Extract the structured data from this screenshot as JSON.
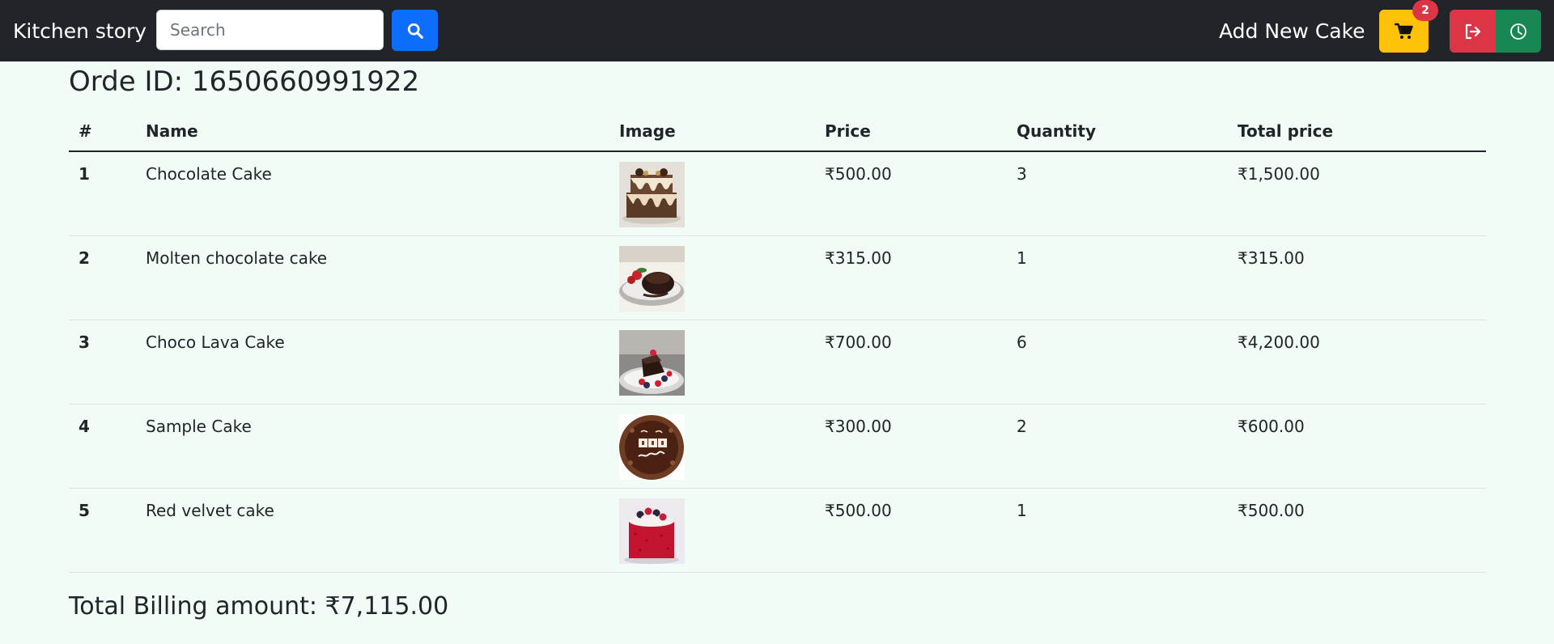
{
  "navbar": {
    "brand": "Kitchen story",
    "search_placeholder": "Search",
    "search_icon": "search-icon",
    "add_cake_label": "Add New Cake",
    "cart_icon": "cart-icon",
    "cart_count": "2",
    "logout_icon": "logout-icon",
    "history_icon": "clock-icon"
  },
  "order": {
    "title": "Orde ID: 1650660991922",
    "columns": [
      "#",
      "Name",
      "Image",
      "Price",
      "Quantity",
      "Total price"
    ],
    "items": [
      {
        "num": "1",
        "name": "Chocolate Cake",
        "image": "chocolate-drip-cake",
        "price": "₹500.00",
        "quantity": "3",
        "total": "₹1,500.00"
      },
      {
        "num": "2",
        "name": "Molten chocolate cake",
        "image": "molten-cake-plate",
        "price": "₹315.00",
        "quantity": "1",
        "total": "₹315.00"
      },
      {
        "num": "3",
        "name": "Choco Lava Cake",
        "image": "lava-cake-berries",
        "price": "₹700.00",
        "quantity": "6",
        "total": "₹4,200.00"
      },
      {
        "num": "4",
        "name": "Sample Cake",
        "image": "birthday-cake",
        "price": "₹300.00",
        "quantity": "2",
        "total": "₹600.00"
      },
      {
        "num": "5",
        "name": "Red velvet cake",
        "image": "red-velvet-cake",
        "price": "₹500.00",
        "quantity": "1",
        "total": "₹500.00"
      }
    ],
    "total_billing": "Total Billing amount: ₹7,115.00"
  },
  "colors": {
    "navbar_bg": "#212529",
    "page_bg": "#f1fcf6",
    "search_btn": "#0d6efd",
    "cart_btn": "#ffc107",
    "badge": "#dc3545",
    "logout_btn": "#dc3545",
    "history_btn": "#198754"
  }
}
